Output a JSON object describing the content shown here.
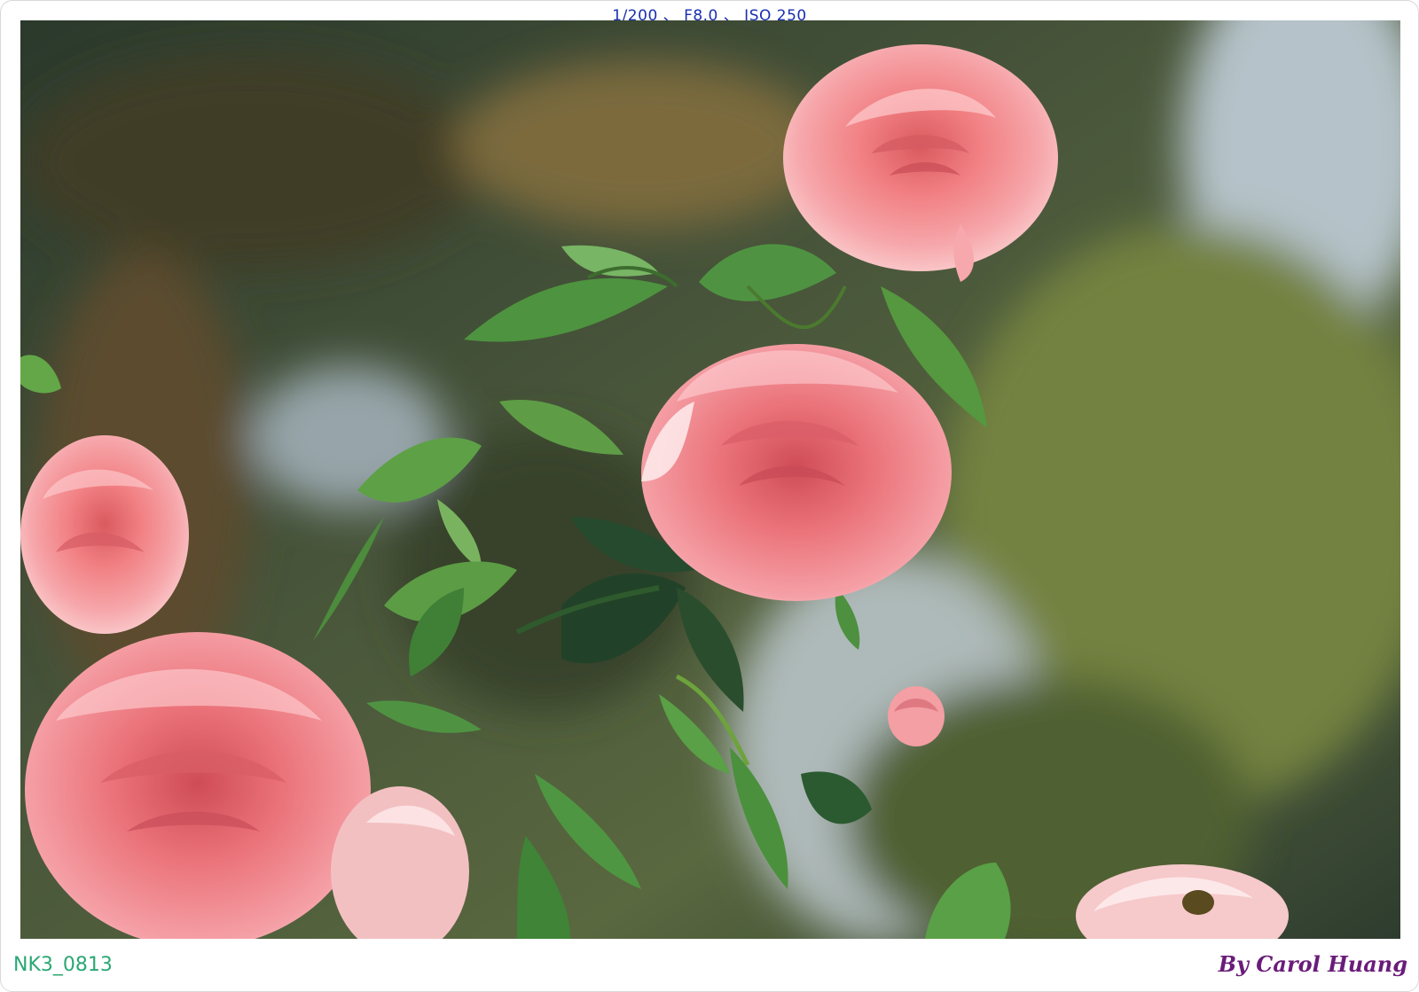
{
  "exif_caption": "1/200 、 F8.0 、 ISO 250",
  "file_name": "NK3_0813",
  "signature": "By Carol Huang",
  "photo_subject": [
    "pink-rose",
    "rose-leaves",
    "blurred-trees"
  ],
  "colors": {
    "exif_text": "#1a2fb0",
    "file_name_text": "#2ba873",
    "signature_text": "#6a1c7a",
    "rose_pink": "#f07f84",
    "leaf_green": "#3f8a3a"
  }
}
